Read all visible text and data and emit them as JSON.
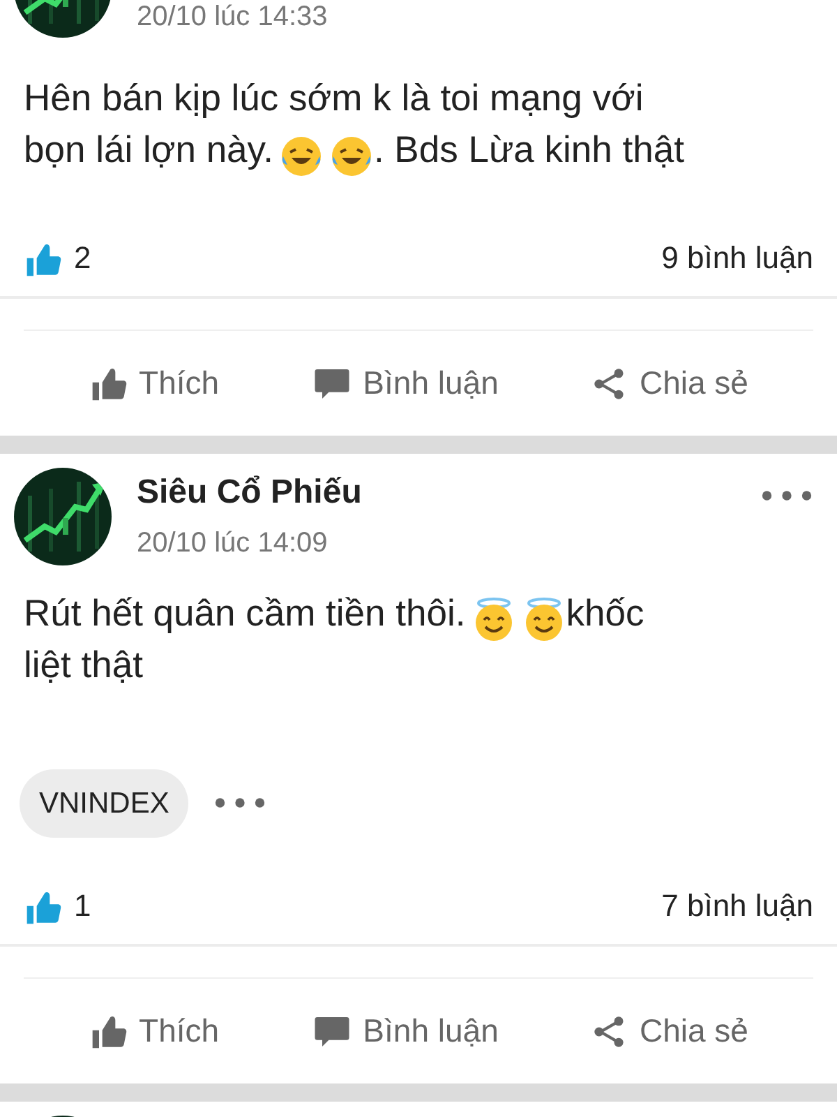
{
  "posts": [
    {
      "date": "20/10 lúc 14:33",
      "show_menu": false,
      "lines": [
        [
          {
            "kind": "text",
            "text": "Hên bán kịp lúc sớm k là toi mạng với"
          }
        ],
        [
          {
            "kind": "text",
            "text": "bọn lái lợn này."
          },
          {
            "kind": "laughing"
          },
          {
            "kind": "laughing"
          },
          {
            "kind": "text",
            "text": ". Bds Lừa kinh thật"
          }
        ]
      ],
      "likes": "2",
      "comments": "9 bình luận",
      "actions": [
        {
          "kind": "like",
          "label": "Thích"
        },
        {
          "kind": "comment",
          "label": "Bình luận"
        },
        {
          "kind": "share",
          "label": "Chia sẻ"
        }
      ]
    },
    {
      "author": "Siêu Cổ Phiếu",
      "date": "20/10 lúc 14:09",
      "show_menu": true,
      "lines": [
        [
          {
            "kind": "text",
            "text": "Rút hết quân cầm tiền thôi."
          },
          {
            "kind": "halo"
          },
          {
            "kind": "halo"
          },
          {
            "kind": "text",
            "text": "khốc"
          }
        ],
        [
          {
            "kind": "text",
            "text": "liệt thật"
          }
        ]
      ],
      "tags": [
        "VNINDEX"
      ],
      "likes": "1",
      "comments": "7 bình luận",
      "actions": [
        {
          "kind": "like",
          "label": "Thích"
        },
        {
          "kind": "comment",
          "label": "Bình luận"
        },
        {
          "kind": "share",
          "label": "Chia sẻ"
        }
      ]
    }
  ]
}
